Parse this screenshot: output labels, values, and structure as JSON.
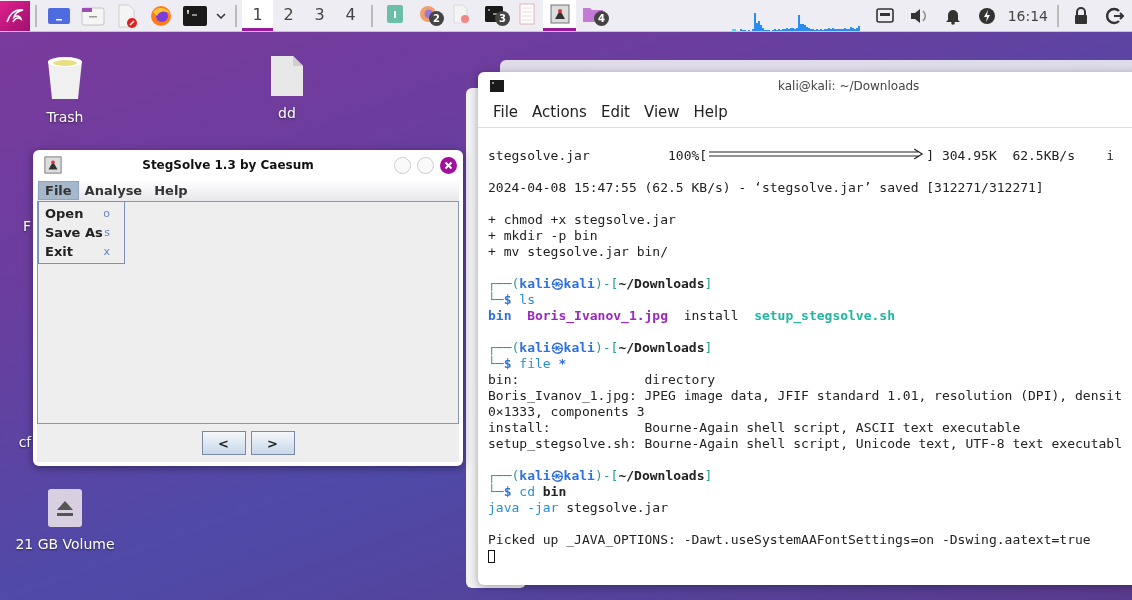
{
  "taskbar": {
    "workspaces": [
      {
        "label": "1",
        "selected": true
      },
      {
        "label": "2",
        "selected": false
      },
      {
        "label": "3",
        "selected": false
      },
      {
        "label": "4",
        "selected": false
      }
    ],
    "tasks": [
      {
        "kind": "notes",
        "selected": false
      },
      {
        "kind": "firefox",
        "badge": "2",
        "selected": false
      },
      {
        "kind": "editor",
        "selected": false
      },
      {
        "kind": "terminal",
        "badge": "3",
        "selected": false
      },
      {
        "kind": "document",
        "selected": false
      },
      {
        "kind": "stegsolve",
        "selected": true
      },
      {
        "kind": "folder",
        "badge": "4",
        "selected": false
      }
    ],
    "clock": "16:14"
  },
  "desktop_icons": [
    {
      "kind": "trash",
      "label": "Trash"
    },
    {
      "kind": "file",
      "label": "dd"
    },
    {
      "kind": "hidden",
      "label": "F"
    },
    {
      "kind": "hidden",
      "label": "cf"
    },
    {
      "kind": "drive",
      "label": "21 GB Volume"
    }
  ],
  "stegsolve": {
    "title": "StegSolve 1.3 by Caesum",
    "menus": [
      {
        "label": "File",
        "selected": true
      },
      {
        "label": "Analyse",
        "selected": false
      },
      {
        "label": "Help",
        "selected": false
      }
    ],
    "menu_items": [
      {
        "label": "Open",
        "shortcut": "o"
      },
      {
        "label": "Save As",
        "shortcut": "s"
      },
      {
        "label": "Exit",
        "shortcut": "x"
      }
    ],
    "buttons": [
      "<",
      ">"
    ]
  },
  "terminal": {
    "title": "kali@kali: ~/Downloads",
    "menus": [
      "File",
      "Actions",
      "Edit",
      "View",
      "Help"
    ],
    "lines": [
      {
        "kind": "progress",
        "segments": [
          {
            "kind": "plain",
            "text": "stegsolve.jar          100%["
          },
          {
            "kind": "bar"
          },
          {
            "kind": "plain",
            "text": "] 304.95K  62.5KB/s    i"
          }
        ]
      },
      {
        "kind": "blank"
      },
      {
        "kind": "text",
        "segments": [
          {
            "kind": "plain",
            "text": "2024-04-08 15:47:55 (62.5 KB/s) - ‘stegsolve.jar’ saved [312271/312271]"
          }
        ]
      },
      {
        "kind": "blank"
      },
      {
        "kind": "text",
        "segments": [
          {
            "kind": "plain",
            "text": "+ chmod +x stegsolve.jar"
          }
        ]
      },
      {
        "kind": "text",
        "segments": [
          {
            "kind": "plain",
            "text": "+ mkdir -p bin"
          }
        ]
      },
      {
        "kind": "text",
        "segments": [
          {
            "kind": "plain",
            "text": "+ mv stegsolve.jar bin/"
          }
        ]
      },
      {
        "kind": "blank"
      },
      {
        "kind": "text",
        "segments": [
          {
            "kind": "frame",
            "text": "┌──("
          },
          {
            "kind": "user",
            "text": "kali㉿kali"
          },
          {
            "kind": "frame",
            "text": ")-["
          },
          {
            "kind": "path",
            "text": "~/Downloads"
          },
          {
            "kind": "frame",
            "text": "]"
          }
        ]
      },
      {
        "kind": "text",
        "segments": [
          {
            "kind": "frame",
            "text": "└─"
          },
          {
            "kind": "dollar",
            "text": "$"
          },
          {
            "kind": "cmd",
            "text": " ls"
          }
        ]
      },
      {
        "kind": "text",
        "segments": [
          {
            "kind": "dir",
            "text": "bin"
          },
          {
            "kind": "image",
            "text": "  Boris_Ivanov_1.jpg"
          },
          {
            "kind": "plain",
            "text": "  install  "
          },
          {
            "kind": "script",
            "text": "setup_stegsolve.sh"
          }
        ]
      },
      {
        "kind": "blank"
      },
      {
        "kind": "text",
        "segments": [
          {
            "kind": "frame",
            "text": "┌──("
          },
          {
            "kind": "user",
            "text": "kali㉿kali"
          },
          {
            "kind": "frame",
            "text": ")-["
          },
          {
            "kind": "path",
            "text": "~/Downloads"
          },
          {
            "kind": "frame",
            "text": "]"
          }
        ]
      },
      {
        "kind": "text",
        "segments": [
          {
            "kind": "frame",
            "text": "└─"
          },
          {
            "kind": "dollar",
            "text": "$"
          },
          {
            "kind": "cmd",
            "text": " file "
          },
          {
            "kind": "dollar",
            "text": "*"
          }
        ]
      },
      {
        "kind": "text",
        "segments": [
          {
            "kind": "plain",
            "text": "bin:                directory"
          }
        ]
      },
      {
        "kind": "text",
        "segments": [
          {
            "kind": "plain",
            "text": "Boris_Ivanov_1.jpg: JPEG image data, JFIF standard 1.01, resolution (DPI), densit"
          }
        ]
      },
      {
        "kind": "text",
        "segments": [
          {
            "kind": "plain",
            "text": "0×1333, components 3"
          }
        ]
      },
      {
        "kind": "text",
        "segments": [
          {
            "kind": "plain",
            "text": "install:            Bourne-Again shell script, ASCII text executable"
          }
        ]
      },
      {
        "kind": "text",
        "segments": [
          {
            "kind": "plain",
            "text": "setup_stegsolve.sh: Bourne-Again shell script, Unicode text, UTF-8 text executabl"
          }
        ]
      },
      {
        "kind": "blank"
      },
      {
        "kind": "text",
        "segments": [
          {
            "kind": "frame",
            "text": "┌──("
          },
          {
            "kind": "user",
            "text": "kali㉿kali"
          },
          {
            "kind": "frame",
            "text": ")-["
          },
          {
            "kind": "path",
            "text": "~/Downloads"
          },
          {
            "kind": "frame",
            "text": "]"
          }
        ]
      },
      {
        "kind": "text",
        "segments": [
          {
            "kind": "frame",
            "text": "└─"
          },
          {
            "kind": "dollar",
            "text": "$"
          },
          {
            "kind": "cmd",
            "text": " cd "
          },
          {
            "kind": "bold",
            "text": "bin"
          }
        ]
      },
      {
        "kind": "text",
        "segments": [
          {
            "kind": "cmd",
            "text": "java -jar"
          },
          {
            "kind": "plain",
            "text": " stegsolve.jar"
          }
        ]
      },
      {
        "kind": "blank"
      },
      {
        "kind": "text",
        "segments": [
          {
            "kind": "plain",
            "text": "Picked up _JAVA_OPTIONS: -Dawt.useSystemAAFontSettings=on -Dswing.aatext=true"
          }
        ]
      },
      {
        "kind": "cursor"
      }
    ]
  }
}
